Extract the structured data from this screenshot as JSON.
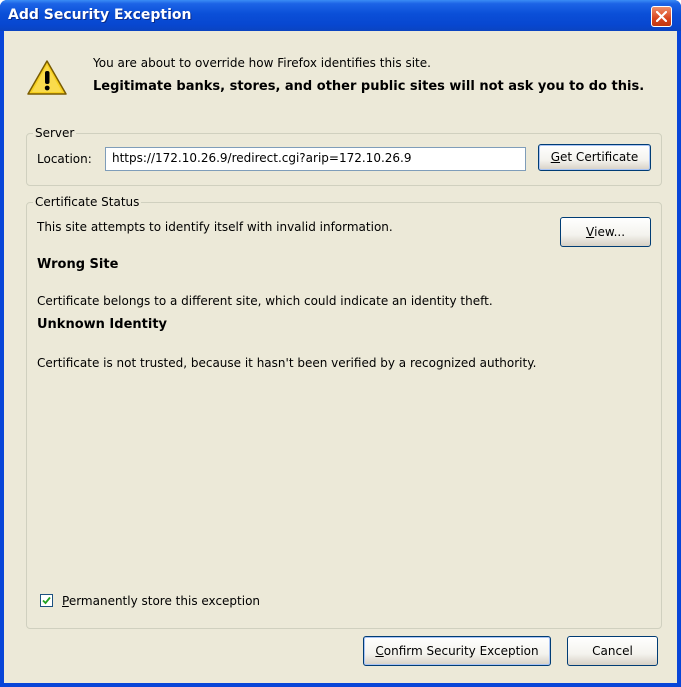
{
  "window": {
    "title": "Add Security Exception"
  },
  "intro": {
    "line1": "You are about to override how Firefox identifies this site.",
    "line2": "Legitimate banks, stores, and other public sites will not ask you to do this."
  },
  "server": {
    "legend": "Server",
    "location_label": "Location:",
    "location_value": "https://172.10.26.9/redirect.cgi?arip=172.10.26.9",
    "get_certificate": {
      "mnemonic": "G",
      "rest": "et Certificate"
    }
  },
  "status": {
    "legend": "Certificate Status",
    "description": "This site attempts to identify itself with invalid information.",
    "view_button": {
      "mnemonic": "V",
      "rest": "iew..."
    },
    "wrong_site_heading": "Wrong Site",
    "wrong_site_text": "Certificate belongs to a different site, which could indicate an identity theft.",
    "unknown_identity_heading": "Unknown Identity",
    "unknown_identity_text": "Certificate is not trusted, because it hasn't been verified by a recognized authority."
  },
  "permanent": {
    "checked": true,
    "mnemonic": "P",
    "rest": "ermanently store this exception"
  },
  "buttons": {
    "confirm": {
      "mnemonic": "C",
      "rest": "onfirm Security Exception"
    },
    "cancel": "Cancel"
  },
  "icons": {
    "warning": "warning-icon",
    "close": "close-icon",
    "check": "checkmark-icon"
  },
  "colors": {
    "title_bar": "#0a4fd8",
    "close_button": "#d8451e",
    "dialog_bg": "#ece9d8",
    "warning": "#f6cf1e"
  }
}
